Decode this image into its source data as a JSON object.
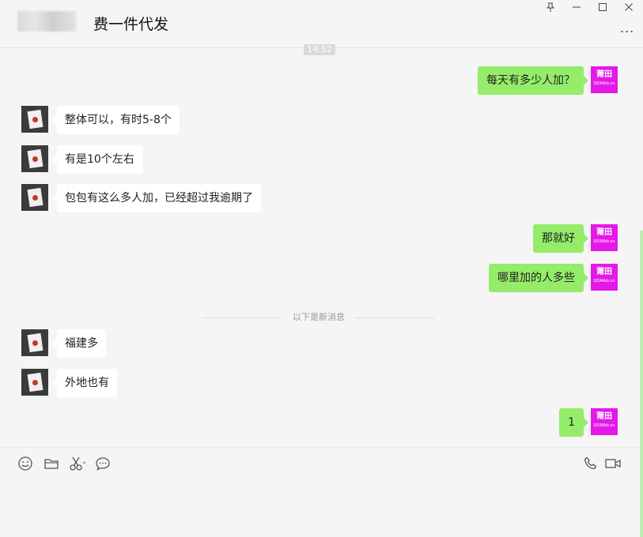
{
  "window": {
    "title": "费一件代发",
    "controls": {
      "pin": "pin-icon",
      "minimize": "minimize-icon",
      "maximize": "maximize-icon",
      "close": "close-icon"
    },
    "more": "..."
  },
  "chat": {
    "timestamp": "14:52",
    "divider_label": "以下是新消息",
    "self_avatar": {
      "line1": "莆田",
      "line2": "QS94kb.cn",
      "color": "#e419e8"
    },
    "messages": [
      {
        "side": "out",
        "text": "每天有多少人加？"
      },
      {
        "side": "in",
        "text": "整体可以，有时5-8个"
      },
      {
        "side": "in",
        "text": "有是10个左右"
      },
      {
        "side": "in",
        "text": "包包有这么多人加，已经超过我逾期了"
      },
      {
        "side": "out",
        "text": "那就好"
      },
      {
        "side": "out",
        "text": "哪里加的人多些"
      },
      {
        "side": "in",
        "text": "福建多"
      },
      {
        "side": "in",
        "text": "外地也有"
      },
      {
        "side": "out",
        "text": "1"
      }
    ]
  },
  "toolbar": {
    "left_icons": [
      "emoji-icon",
      "folder-icon",
      "scissors-icon",
      "chat-history-icon"
    ],
    "right_icons": [
      "phone-icon",
      "video-icon"
    ]
  },
  "colors": {
    "out_bubble": "#95ec69",
    "in_bubble": "#ffffff",
    "background": "#f5f5f5"
  }
}
